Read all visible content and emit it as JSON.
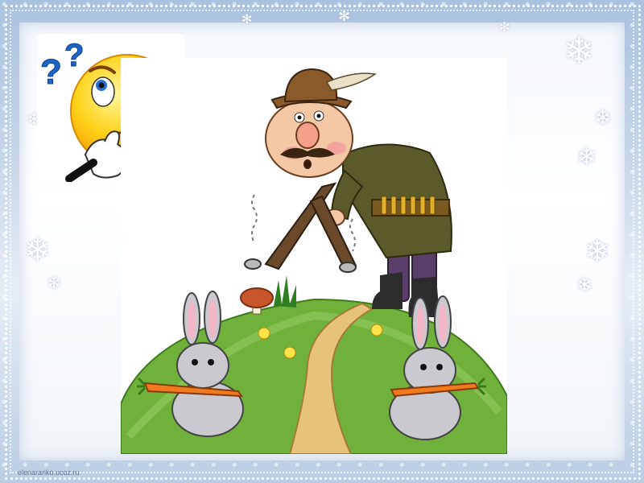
{
  "slide": {
    "watermark": "elenaranko.ucoz.ru"
  },
  "illustration": {
    "question_marks": "??"
  },
  "colors": {
    "frame_blue": "#a9c2df",
    "emoji_yellow": "#ffd21a",
    "question_blue": "#1e63c8",
    "hill_green": "#6fb13a",
    "path_tan": "#e6c27a",
    "coat_olive": "#5b5a2a"
  },
  "icons": [
    "thinking-face-icon",
    "question-mark-icon",
    "snowflake-icon"
  ]
}
